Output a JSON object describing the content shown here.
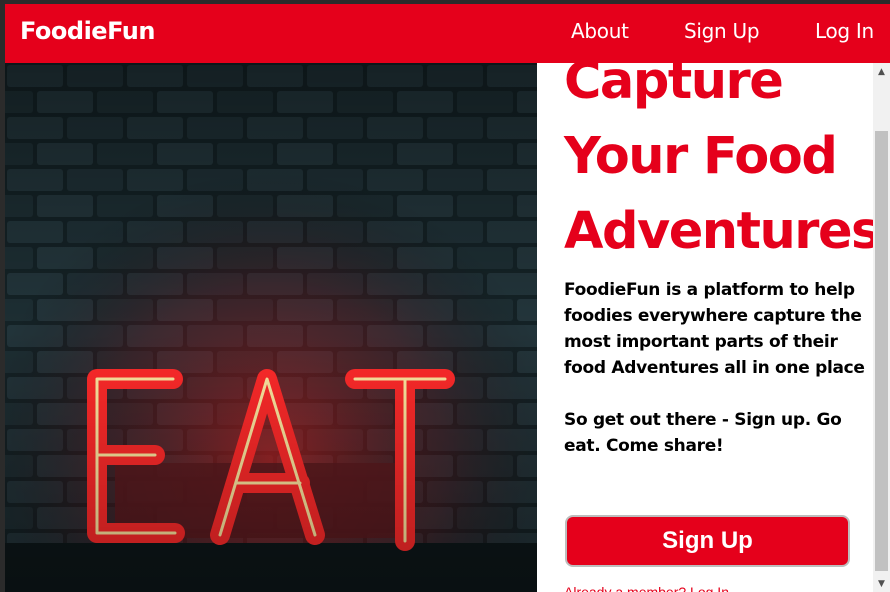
{
  "navbar": {
    "brand": "FoodieFun",
    "links": [
      "About",
      "Sign Up",
      "Log In"
    ],
    "background": "#e5001b"
  },
  "hero": {
    "image": {
      "alt": "Red neon EAT sign on a dark brick wall",
      "sign_text": "EAT",
      "neon_color": "#ff2a2a",
      "wall_color": "#1a2a30"
    },
    "title_lines": [
      "Capture",
      "Your Food",
      "Adventures"
    ],
    "description": "FoodieFun is a platform to help foodies everywhere capture the most important parts of their food Adventures all in one place",
    "cta_text": "So get out there - Sign up. Go eat. Come share!",
    "signup_button": "Sign Up",
    "login_prompt": "Already a member? Log In",
    "accent_color": "#e5001b"
  },
  "scrollbar": {
    "up_icon": "chevron-up-icon",
    "down_icon": "chevron-down-icon"
  }
}
